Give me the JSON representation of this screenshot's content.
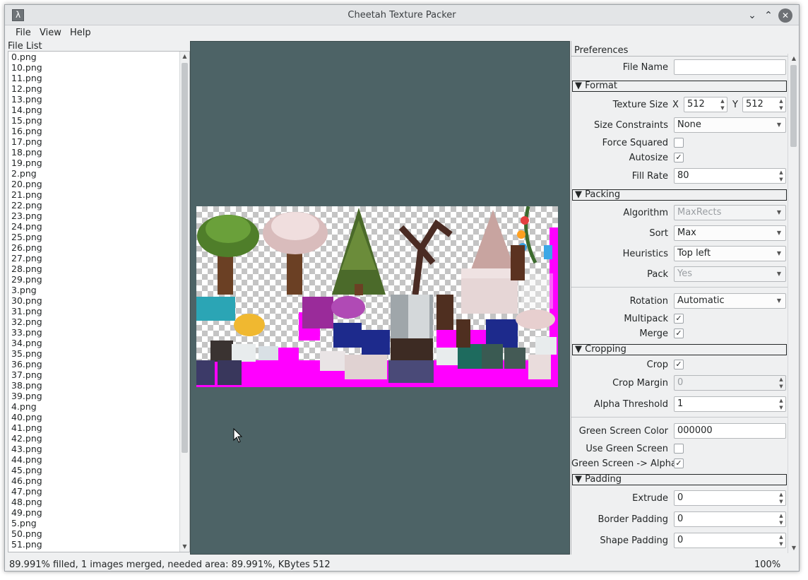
{
  "window": {
    "title": "Cheetah Texture Packer"
  },
  "menu": {
    "file": "File",
    "view": "View",
    "help": "Help"
  },
  "file_list": {
    "header": "File List",
    "items": [
      "0.png",
      "10.png",
      "11.png",
      "12.png",
      "13.png",
      "14.png",
      "15.png",
      "16.png",
      "17.png",
      "18.png",
      "19.png",
      "2.png",
      "20.png",
      "21.png",
      "22.png",
      "23.png",
      "24.png",
      "25.png",
      "26.png",
      "27.png",
      "28.png",
      "29.png",
      "3.png",
      "30.png",
      "31.png",
      "32.png",
      "33.png",
      "34.png",
      "35.png",
      "36.png",
      "37.png",
      "38.png",
      "39.png",
      "4.png",
      "40.png",
      "41.png",
      "42.png",
      "43.png",
      "44.png",
      "45.png",
      "46.png",
      "47.png",
      "48.png",
      "49.png",
      "5.png",
      "50.png",
      "51.png"
    ]
  },
  "preferences": {
    "title": "Preferences",
    "file_name": {
      "label": "File Name",
      "value": ""
    },
    "format": {
      "header": "▼ Format",
      "texture_size": {
        "label": "Texture Size",
        "x_label": "X",
        "x": "512",
        "y_label": "Y",
        "y": "512"
      },
      "size_constraints": {
        "label": "Size Constraints",
        "value": "None"
      },
      "force_squared": {
        "label": "Force Squared",
        "checked": ""
      },
      "autosize": {
        "label": "Autosize",
        "checked": "✓"
      },
      "fill_rate": {
        "label": "Fill Rate",
        "value": "80"
      }
    },
    "packing": {
      "header": "▼ Packing",
      "algorithm": {
        "label": "Algorithm",
        "value": "MaxRects"
      },
      "sort": {
        "label": "Sort",
        "value": "Max"
      },
      "heuristics": {
        "label": "Heuristics",
        "value": "Top left"
      },
      "pack": {
        "label": "Pack",
        "value": "Yes"
      },
      "rotation": {
        "label": "Rotation",
        "value": "Automatic"
      },
      "multipack": {
        "label": "Multipack",
        "checked": "✓"
      },
      "merge": {
        "label": "Merge",
        "checked": "✓"
      }
    },
    "cropping": {
      "header": "▼ Cropping",
      "crop": {
        "label": "Crop",
        "checked": "✓"
      },
      "crop_margin": {
        "label": "Crop Margin",
        "value": "0"
      },
      "alpha_threshold": {
        "label": "Alpha Threshold",
        "value": "1"
      },
      "green_screen_color": {
        "label": "Green Screen Color",
        "value": "000000"
      },
      "use_green_screen": {
        "label": "Use Green Screen",
        "checked": ""
      },
      "green_screen_alpha": {
        "label": "Green Screen -> Alpha",
        "checked": "✓"
      }
    },
    "padding": {
      "header": "▼ Padding",
      "extrude": {
        "label": "Extrude",
        "value": "0"
      },
      "border_padding": {
        "label": "Border Padding",
        "value": "0"
      },
      "shape_padding": {
        "label": "Shape Padding",
        "value": "0"
      }
    }
  },
  "status": {
    "text": "89.991% filled, 1 images merged, needed area: 89.991%, KBytes 512",
    "zoom": "100%"
  },
  "colors": {
    "canvas_bg": "#4d6366",
    "magenta": "#ff00ff"
  }
}
